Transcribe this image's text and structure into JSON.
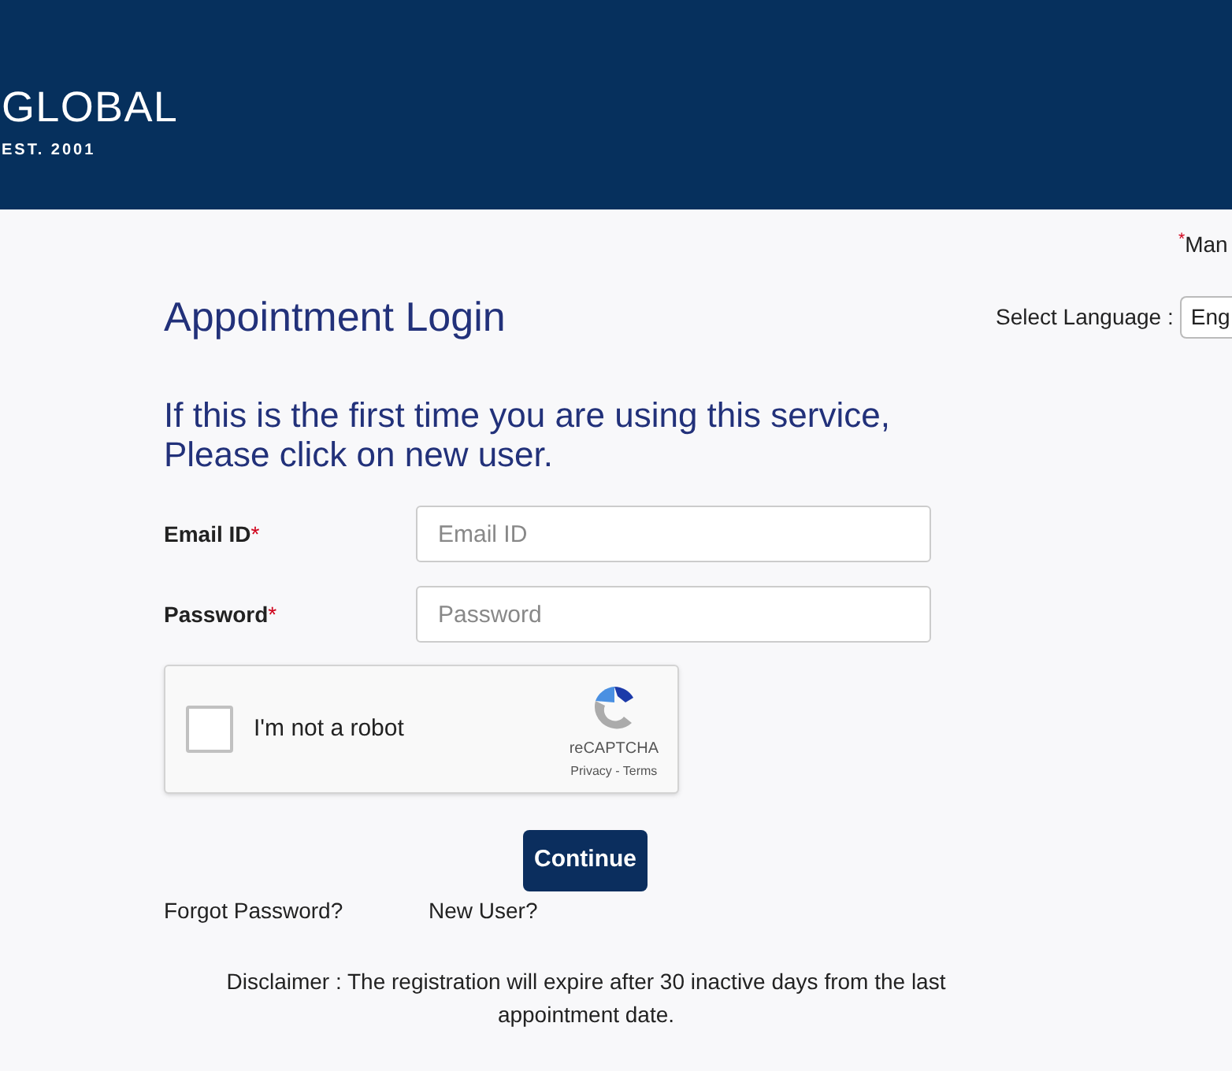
{
  "header": {
    "logo_text": "GLOBAL",
    "logo_tagline": "EST. 2001"
  },
  "mandatory_note": {
    "mark": "*",
    "text": "Man"
  },
  "title": "Appointment Login",
  "language": {
    "label": "Select Language :",
    "value": "Eng"
  },
  "intro": "If this is the first time you are using this service, Please click on new user.",
  "fields": [
    {
      "label": "Email ID",
      "required_mark": "*",
      "placeholder": "Email ID"
    },
    {
      "label": "Password",
      "required_mark": "*",
      "placeholder": "Password"
    }
  ],
  "captcha": {
    "label": "I'm not a robot",
    "checked": false,
    "brand": "reCAPTCHA",
    "links": "Privacy - Terms"
  },
  "submit": "Continue",
  "links": [
    "Forgot Password?",
    "New User?"
  ],
  "disclaimer": "Disclaimer : The registration will expire after 30 inactive days from the last appointment date."
}
